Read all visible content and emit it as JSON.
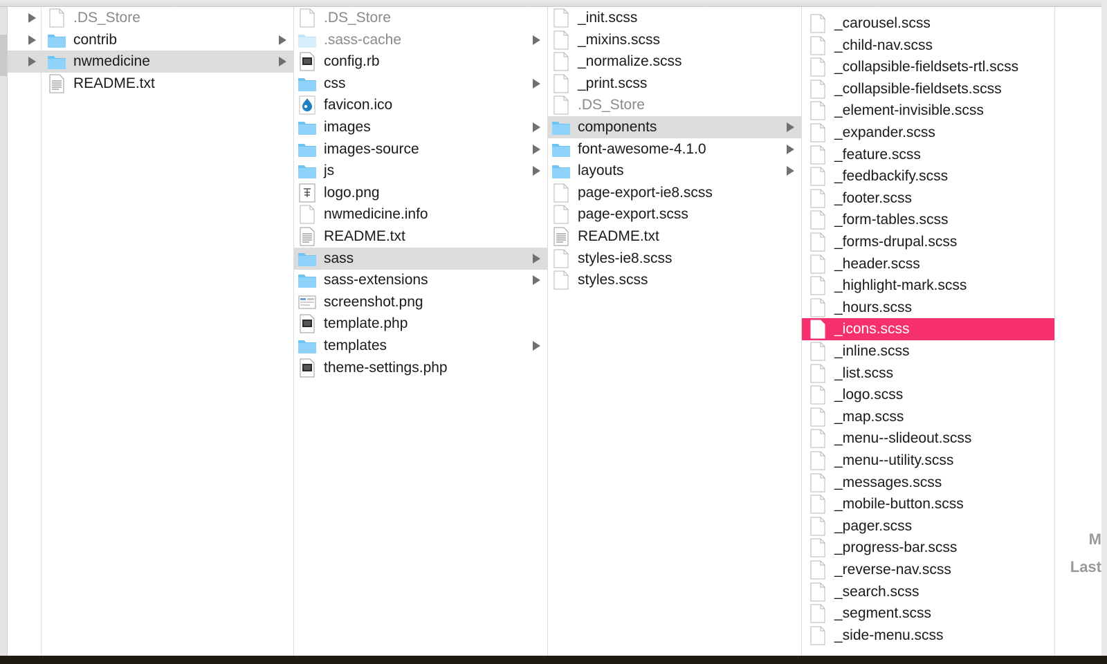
{
  "columns": [
    {
      "items": [
        {
          "name": ".DS_Store",
          "type": "file",
          "dim": true,
          "expand": true
        },
        {
          "name": "contrib",
          "type": "folder",
          "expand": true,
          "chevron": true
        },
        {
          "name": "nwmedicine",
          "type": "folder",
          "expand": true,
          "chevron": true,
          "active": true
        },
        {
          "name": "README.txt",
          "type": "text"
        }
      ]
    },
    {
      "items": [
        {
          "name": ".DS_Store",
          "type": "file",
          "dim": true
        },
        {
          "name": ".sass-cache",
          "type": "folder-light",
          "dim": true,
          "chevron": true
        },
        {
          "name": "config.rb",
          "type": "exec"
        },
        {
          "name": "css",
          "type": "folder",
          "chevron": true
        },
        {
          "name": "favicon.ico",
          "type": "drupal"
        },
        {
          "name": "images",
          "type": "folder",
          "chevron": true
        },
        {
          "name": "images-source",
          "type": "folder",
          "chevron": true
        },
        {
          "name": "js",
          "type": "folder",
          "chevron": true
        },
        {
          "name": "logo.png",
          "type": "image"
        },
        {
          "name": "nwmedicine.info",
          "type": "file"
        },
        {
          "name": "README.txt",
          "type": "text"
        },
        {
          "name": "sass",
          "type": "folder",
          "chevron": true,
          "active": true
        },
        {
          "name": "sass-extensions",
          "type": "folder",
          "chevron": true
        },
        {
          "name": "screenshot.png",
          "type": "image-shot"
        },
        {
          "name": "template.php",
          "type": "exec"
        },
        {
          "name": "templates",
          "type": "folder",
          "chevron": true
        },
        {
          "name": "theme-settings.php",
          "type": "exec"
        }
      ]
    },
    {
      "items": [
        {
          "name": "_init.scss",
          "type": "file"
        },
        {
          "name": "_mixins.scss",
          "type": "file"
        },
        {
          "name": "_normalize.scss",
          "type": "file"
        },
        {
          "name": "_print.scss",
          "type": "file"
        },
        {
          "name": ".DS_Store",
          "type": "file",
          "dim": true
        },
        {
          "name": "components",
          "type": "folder",
          "chevron": true,
          "active": true
        },
        {
          "name": "font-awesome-4.1.0",
          "type": "folder",
          "chevron": true
        },
        {
          "name": "layouts",
          "type": "folder",
          "chevron": true
        },
        {
          "name": "page-export-ie8.scss",
          "type": "file"
        },
        {
          "name": "page-export.scss",
          "type": "file"
        },
        {
          "name": "README.txt",
          "type": "text"
        },
        {
          "name": "styles-ie8.scss",
          "type": "file"
        },
        {
          "name": "styles.scss",
          "type": "file"
        }
      ]
    },
    {
      "items": [
        {
          "name": "_carousel.scss",
          "type": "file"
        },
        {
          "name": "_child-nav.scss",
          "type": "file"
        },
        {
          "name": "_collapsible-fieldsets-rtl.scss",
          "type": "file"
        },
        {
          "name": "_collapsible-fieldsets.scss",
          "type": "file"
        },
        {
          "name": "_element-invisible.scss",
          "type": "file"
        },
        {
          "name": "_expander.scss",
          "type": "file"
        },
        {
          "name": "_feature.scss",
          "type": "file"
        },
        {
          "name": "_feedbackify.scss",
          "type": "file"
        },
        {
          "name": "_footer.scss",
          "type": "file"
        },
        {
          "name": "_form-tables.scss",
          "type": "file"
        },
        {
          "name": "_forms-drupal.scss",
          "type": "file"
        },
        {
          "name": "_header.scss",
          "type": "file"
        },
        {
          "name": "_highlight-mark.scss",
          "type": "file"
        },
        {
          "name": "_hours.scss",
          "type": "file"
        },
        {
          "name": "_icons.scss",
          "type": "file",
          "selected": true
        },
        {
          "name": "_inline.scss",
          "type": "file"
        },
        {
          "name": "_list.scss",
          "type": "file"
        },
        {
          "name": "_logo.scss",
          "type": "file"
        },
        {
          "name": "_map.scss",
          "type": "file"
        },
        {
          "name": "_menu--slideout.scss",
          "type": "file"
        },
        {
          "name": "_menu--utility.scss",
          "type": "file"
        },
        {
          "name": "_messages.scss",
          "type": "file"
        },
        {
          "name": "_mobile-button.scss",
          "type": "file"
        },
        {
          "name": "_pager.scss",
          "type": "file"
        },
        {
          "name": "_progress-bar.scss",
          "type": "file"
        },
        {
          "name": "_reverse-nav.scss",
          "type": "file"
        },
        {
          "name": "_search.scss",
          "type": "file"
        },
        {
          "name": "_segment.scss",
          "type": "file"
        },
        {
          "name": "_side-menu.scss",
          "type": "file"
        }
      ]
    }
  ],
  "preview": {
    "line1": "M",
    "line2": "Last"
  },
  "colors": {
    "selection": "#f5306d",
    "active": "#dcdcdc",
    "folder": "#6cc4f5"
  },
  "icons": {
    "folder": "folder-icon",
    "folder-light": "folder-icon",
    "file": "document-icon",
    "text": "text-document-icon",
    "exec": "executable-icon",
    "drupal": "drupal-icon",
    "image": "image-icon",
    "image-shot": "image-icon"
  }
}
